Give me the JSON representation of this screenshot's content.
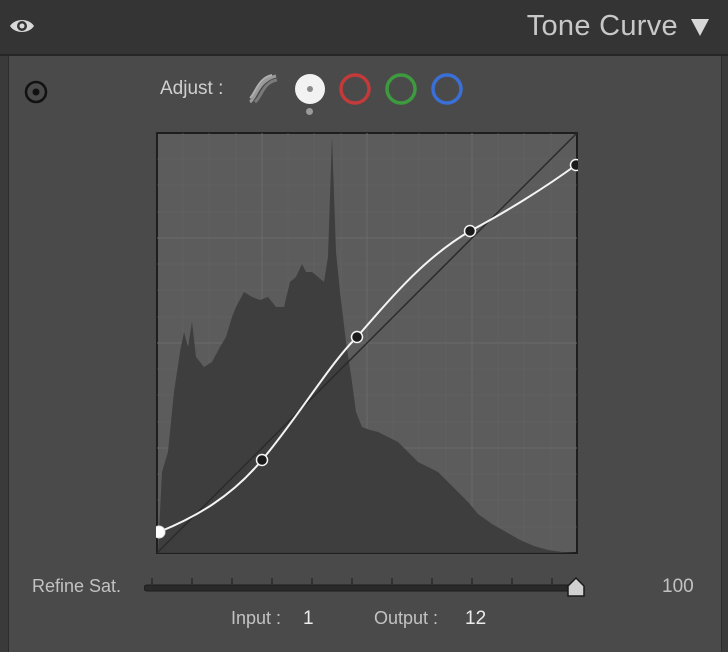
{
  "header": {
    "title": "Tone Curve",
    "eye_icon": "eye-icon",
    "collapse_icon": "triangle-down-icon"
  },
  "adjust": {
    "label": "Adjust :",
    "channels": [
      {
        "name": "parametric",
        "icon": "parametric-curve-icon"
      },
      {
        "name": "point-curve",
        "icon": "white-filled-circle",
        "color": "#f2f2f2",
        "selected": true
      },
      {
        "name": "red",
        "icon": "red-ring",
        "color": "#c23a3a"
      },
      {
        "name": "green",
        "icon": "green-ring",
        "color": "#3e9a3e"
      },
      {
        "name": "blue",
        "icon": "blue-ring",
        "color": "#3a6fd8"
      }
    ]
  },
  "curve": {
    "points": [
      [
        1,
        12
      ],
      [
        25,
        22
      ],
      [
        48,
        51
      ],
      [
        75,
        77
      ],
      [
        100,
        93
      ]
    ],
    "selected_point": 0
  },
  "refine": {
    "label": "Refine Sat.",
    "value": "100",
    "fraction": 1.0
  },
  "readout": {
    "input_label": "Input :",
    "input_value": "1",
    "output_label": "Output :",
    "output_value": "12"
  }
}
